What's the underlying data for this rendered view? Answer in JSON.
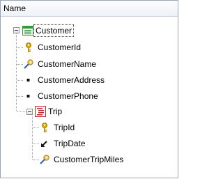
{
  "header": {
    "column_label": "Name"
  },
  "tree": {
    "root": {
      "label": "Customer",
      "icon": "transaction-icon",
      "expanded": true,
      "children": [
        {
          "label": "CustomerId",
          "icon": "key-icon"
        },
        {
          "label": "CustomerName",
          "icon": "description-key-icon"
        },
        {
          "label": "CustomerAddress",
          "icon": "attribute-dot-icon"
        },
        {
          "label": "CustomerPhone",
          "icon": "attribute-dot-icon"
        },
        {
          "label": "Trip",
          "icon": "level-icon",
          "expanded": true,
          "children": [
            {
              "label": "TripId",
              "icon": "key-icon"
            },
            {
              "label": "TripDate",
              "icon": "inferred-arrow-icon"
            },
            {
              "label": "CustomerTripMiles",
              "icon": "description-key-icon"
            }
          ]
        }
      ]
    }
  },
  "colors": {
    "border": "#9aa6b6",
    "transaction_icon": "#2e9a3a",
    "level_icon": "#c0282d",
    "key_icon": "#d9a400",
    "description_icon": "#c09000"
  }
}
